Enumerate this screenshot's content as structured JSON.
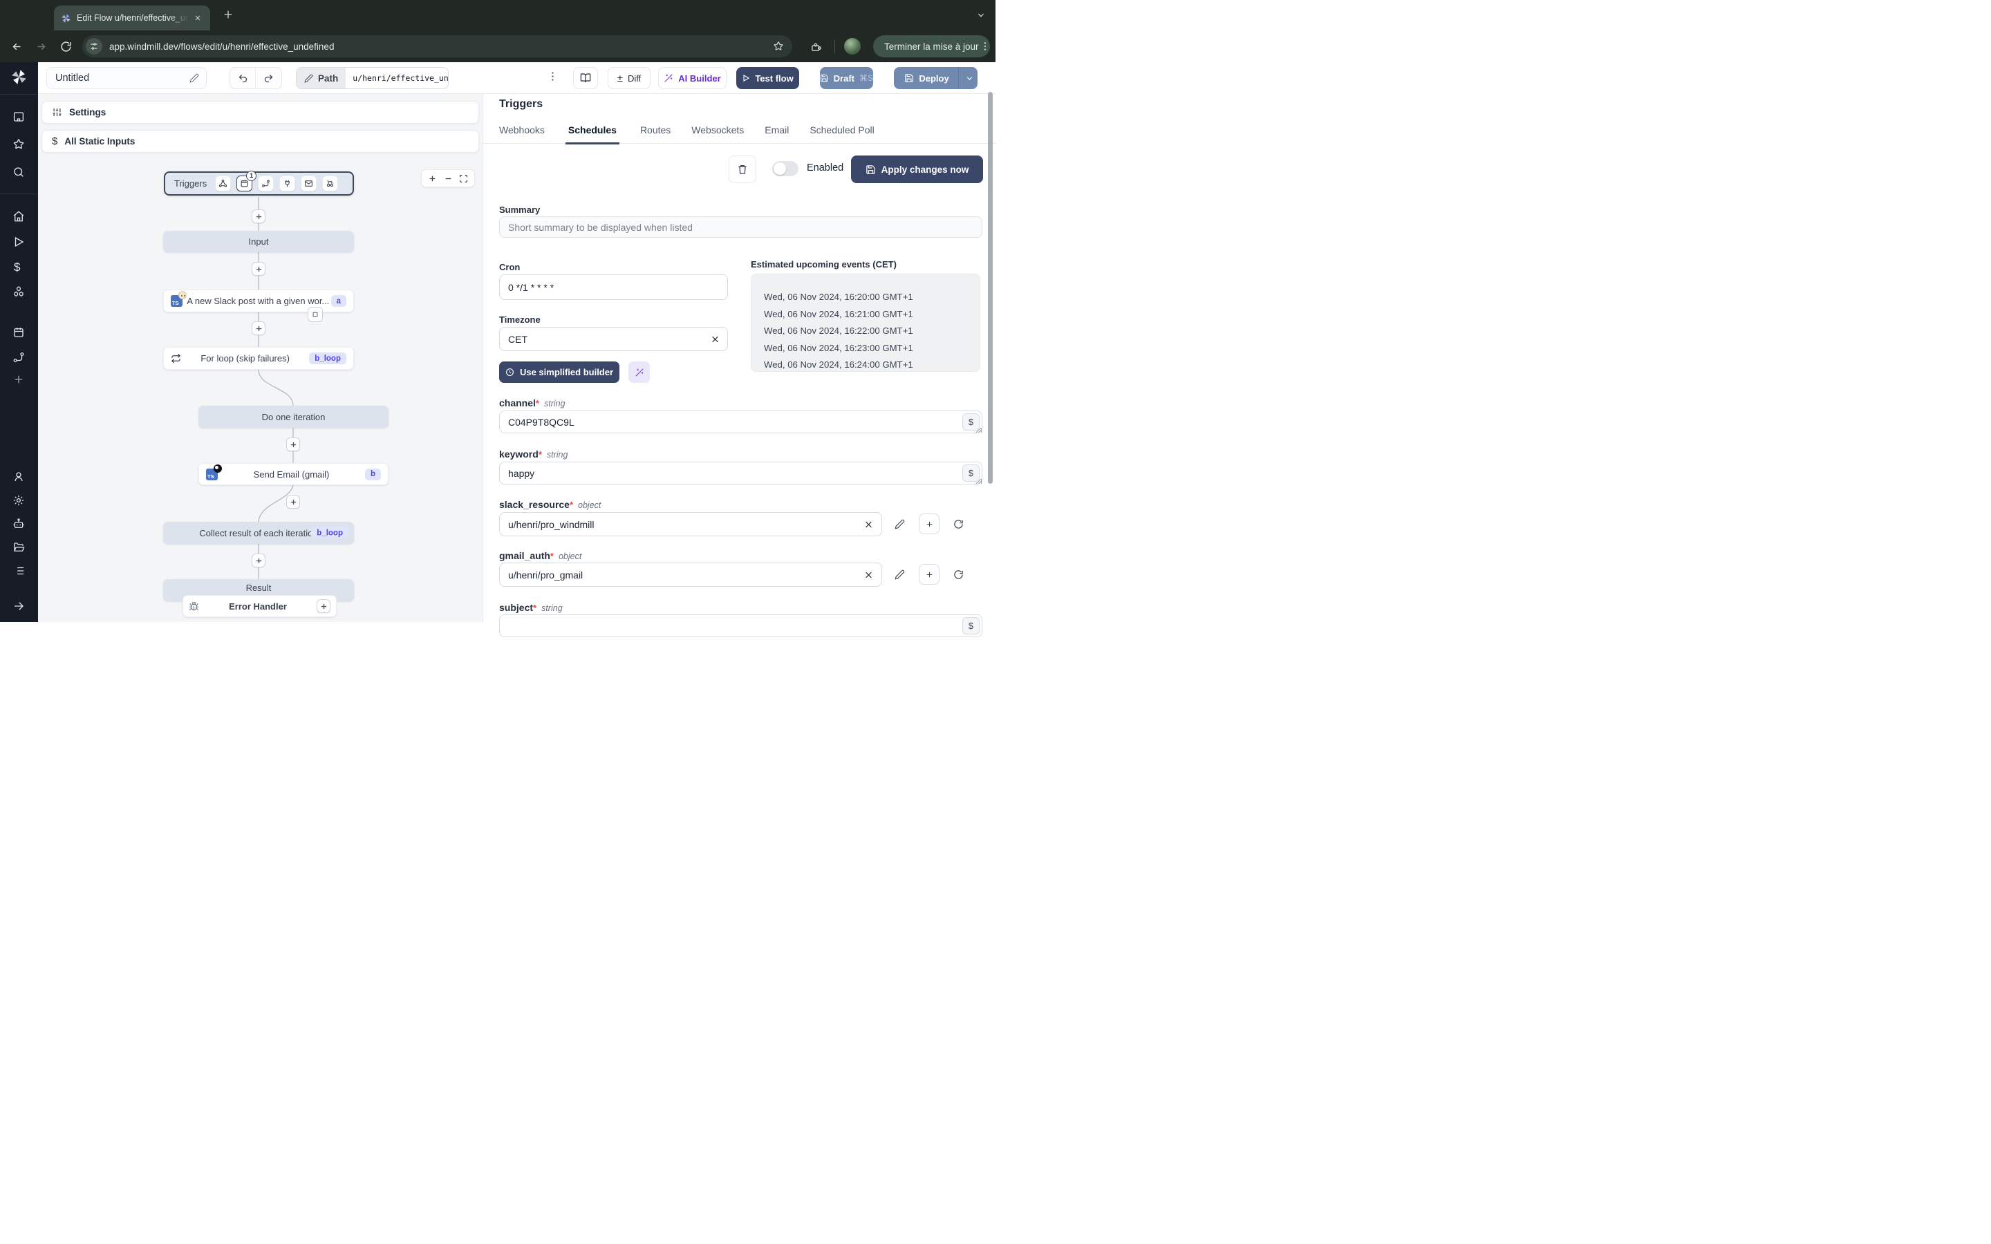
{
  "colors": {
    "accent_navy": "#3a4769",
    "accent_slate": "#7289af",
    "ai_purple": "#6d28d9",
    "badge_indigo": "#4f46e5",
    "chrome_dark": "#222925"
  },
  "browser": {
    "tab_title": "Edit Flow u/henri/effective_un",
    "url": "app.windmill.dev/flows/edit/u/henri/effective_undefined",
    "update_button": "Terminer la mise à jour"
  },
  "toolbar": {
    "flow_name": "Untitled",
    "path_label": "Path",
    "path_value": "u/henri/effective_undef",
    "diff_sign": "±",
    "diff_label": "Diff",
    "ai_builder_label": "AI Builder",
    "test_flow_label": "Test flow",
    "draft_label": "Draft",
    "draft_shortcut": "⌘S",
    "deploy_label": "Deploy"
  },
  "flow_panel": {
    "settings_label": "Settings",
    "static_dollar": "$",
    "static_inputs_label": "All Static Inputs",
    "nodes": {
      "triggers": "Triggers",
      "calendar_badge": "1",
      "input": "Input",
      "ts": "TS",
      "slack": "A new Slack post with a given wor...",
      "slack_badge": "a",
      "forloop": "For loop (skip failures)",
      "forloop_badge": "b_loop",
      "do_iteration": "Do one iteration",
      "send_email": "Send Email (gmail)",
      "send_email_badge": "b",
      "collect": "Collect result of each iteration",
      "collect_badge": "b_loop",
      "result": "Result",
      "error_handler": "Error Handler"
    }
  },
  "right_panel": {
    "title": "Triggers",
    "tabs": [
      {
        "label": "Webhooks"
      },
      {
        "label": "Schedules"
      },
      {
        "label": "Routes"
      },
      {
        "label": "Websockets"
      },
      {
        "label": "Email"
      },
      {
        "label": "Scheduled Poll"
      }
    ],
    "enabled_label": "Enabled",
    "apply_button": "Apply changes now",
    "summary_label": "Summary",
    "summary_placeholder": "Short summary to be displayed when listed",
    "cron_label": "Cron",
    "cron_value": "0 */1 * * * *",
    "timezone_label": "Timezone",
    "timezone_value": "CET",
    "events_title": "Estimated upcoming events (CET)",
    "events": [
      "Wed, 06 Nov 2024, 16:20:00 GMT+1",
      "Wed, 06 Nov 2024, 16:21:00 GMT+1",
      "Wed, 06 Nov 2024, 16:22:00 GMT+1",
      "Wed, 06 Nov 2024, 16:23:00 GMT+1",
      "Wed, 06 Nov 2024, 16:24:00 GMT+1"
    ],
    "builder_button": "Use simplified builder",
    "dollar_sign": "$",
    "fields": {
      "channel": {
        "name": "channel",
        "req": "*",
        "type": "string",
        "value": "C04P9T8QC9L"
      },
      "keyword": {
        "name": "keyword",
        "req": "*",
        "type": "string",
        "value": "happy"
      },
      "slack_resource": {
        "name": "slack_resource",
        "req": "*",
        "type": "object",
        "value": "u/henri/pro_windmill"
      },
      "gmail_auth": {
        "name": "gmail_auth",
        "req": "*",
        "type": "object",
        "value": "u/henri/pro_gmail"
      },
      "subject": {
        "name": "subject",
        "req": "*",
        "type": "string"
      }
    }
  }
}
